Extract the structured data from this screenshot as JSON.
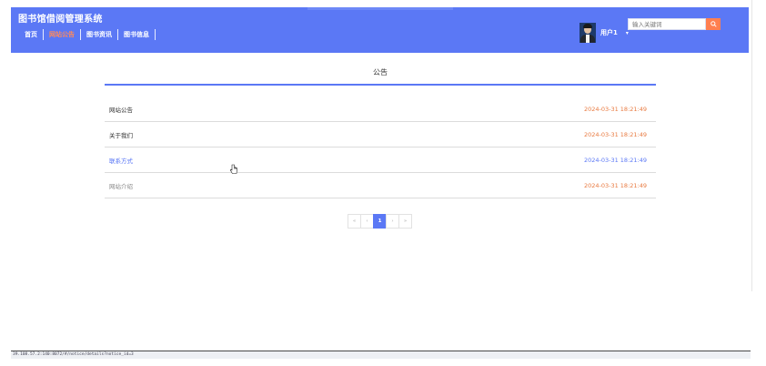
{
  "header": {
    "site_title": "图书馆借阅管理系统",
    "nav": [
      {
        "label": "首页",
        "active": false
      },
      {
        "label": "网站公告",
        "active": true
      },
      {
        "label": "图书资讯",
        "active": false
      },
      {
        "label": "图书信息",
        "active": false
      }
    ],
    "user": {
      "name": "用户1",
      "caret": "▾"
    },
    "search": {
      "placeholder": "输入关键词",
      "value": "",
      "button_icon": "search-icon"
    }
  },
  "notice": {
    "title": "公告",
    "items": [
      {
        "title": "网站公告",
        "date": "2024-03-31 18:21:49"
      },
      {
        "title": "关于我们",
        "date": "2024-03-31 18:21:49"
      },
      {
        "title": "联系方式",
        "date": "2024-03-31 18:21:49"
      },
      {
        "title": "网站介绍",
        "date": "2024-03-31 18:21:49"
      }
    ]
  },
  "pagination": {
    "first": "«",
    "prev": "‹",
    "current_page": "1",
    "next": "›",
    "last": "»"
  },
  "status_bar": {
    "url": "39.108.57.2:140:8072/#/notice/details?notice_id=3"
  },
  "colors": {
    "header_bg": "#5b78f5",
    "accent_orange": "#ff7f50",
    "date_color": "#e8793f",
    "link_hover": "#5b78f5"
  }
}
